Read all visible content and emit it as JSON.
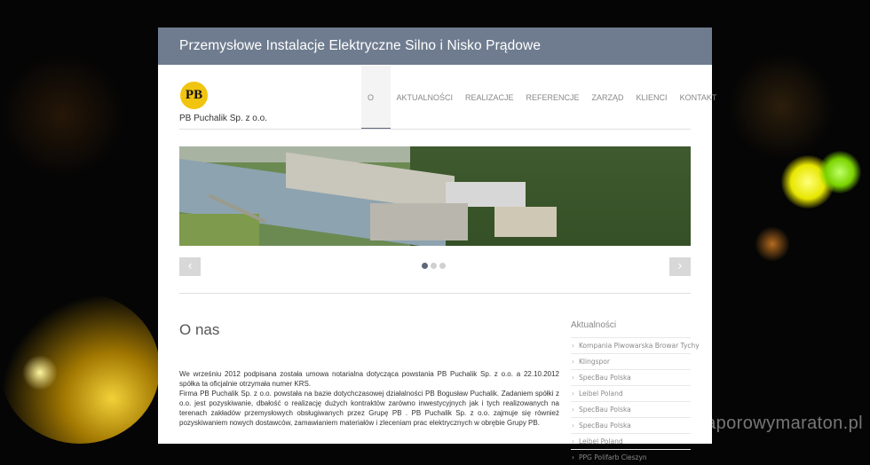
{
  "header": {
    "title": "Przemysłowe Instalacje Elektryczne Silno i Nisko Prądowe"
  },
  "brand": {
    "logo": "PB",
    "company": "PB Puchalik Sp. z o.o."
  },
  "nav": {
    "items": [
      "O NAS",
      "AKTUALNOŚCI",
      "REALIZACJE",
      "REFERENCJE",
      "ZARZĄD",
      "KLIENCI",
      "KONTAKT"
    ],
    "active": "O NAS"
  },
  "slider": {
    "prev": "‹",
    "next": "›"
  },
  "page": {
    "title": "O nas",
    "paragraphs": [
      "We wrześniu 2012 podpisana została umowa notarialna dotycząca powstania PB Puchalik Sp. z o.o. a 22.10.2012 spółka ta oficjalnie otrzymała numer KRS.",
      "Firma PB Puchalik Sp. z o.o. powstała na bazie dotychczasowej działalności PB Bogusław Puchalik. Zadaniem spółki z o.o. jest pozyskiwanie, dbałość o realizację dużych kontraktów zarówno inwestycyjnych jak i tych realizowanych na terenach zakładów przemysłowych obsługiwanych przez Grupę PB . PB Puchalik Sp. z o.o. zajmuje się również pozyskiwaniem nowych dostawców, zamawianiem materiałów i zleceniam prac elektrycznych w obrębie Grupy PB."
    ]
  },
  "sidebar": {
    "title": "Aktualności",
    "links": [
      "Kompania Piwowarska Browar Tychy",
      "Klingspor",
      "SpecBau Polska",
      "Leibel Poland",
      "SpecBau Polska",
      "SpecBau Polska",
      "Leibel Poland",
      "PPG Polifarb Cieszyn"
    ]
  },
  "watermark": "www.zaporowymaraton.pl"
}
